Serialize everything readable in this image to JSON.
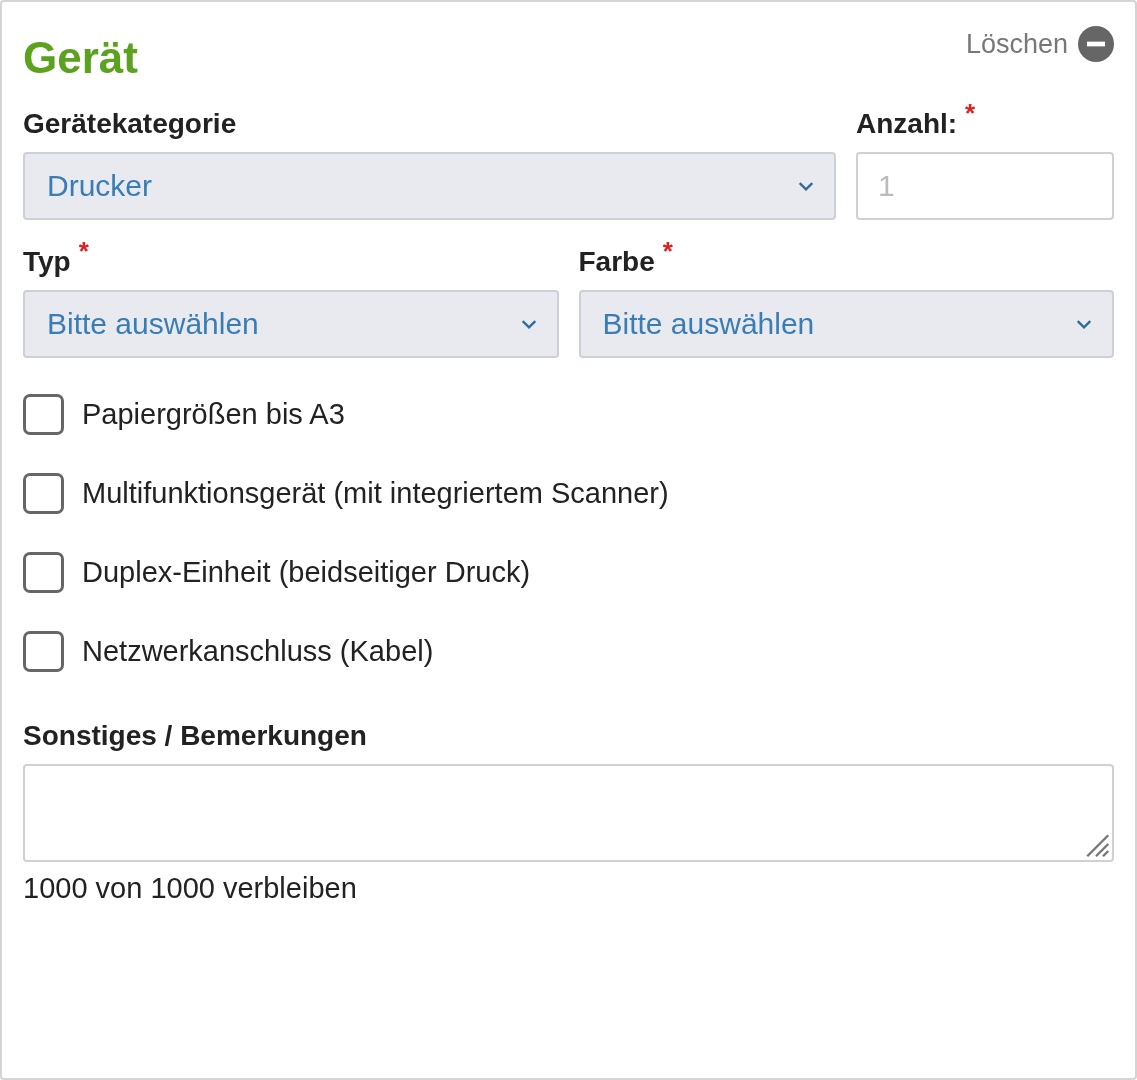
{
  "card": {
    "title": "Gerät",
    "delete_label": "Löschen"
  },
  "required_mark": "*",
  "field_rows": [
    {
      "fields": [
        {
          "kind": "select",
          "label": "Gerätekategorie",
          "required": false,
          "value": "Drucker"
        },
        {
          "kind": "number",
          "label": "Anzahl:",
          "required": true,
          "placeholder": "1"
        }
      ]
    },
    {
      "fields": [
        {
          "kind": "select",
          "label": "Typ",
          "required": true,
          "value": "Bitte auswählen"
        },
        {
          "kind": "select",
          "label": "Farbe",
          "required": true,
          "value": "Bitte auswählen"
        }
      ]
    }
  ],
  "options": [
    {
      "label": "Papiergrößen bis A3",
      "checked": false
    },
    {
      "label": "Multifunktionsgerät (mit integriertem Scanner)",
      "checked": false
    },
    {
      "label": "Duplex-Einheit (beidseitiger Druck)",
      "checked": false
    },
    {
      "label": "Netzwerkanschluss (Kabel)",
      "checked": false
    }
  ],
  "remarks": {
    "label": "Sonstiges / Bemerkungen",
    "counter": "1000 von 1000 verbleiben"
  }
}
